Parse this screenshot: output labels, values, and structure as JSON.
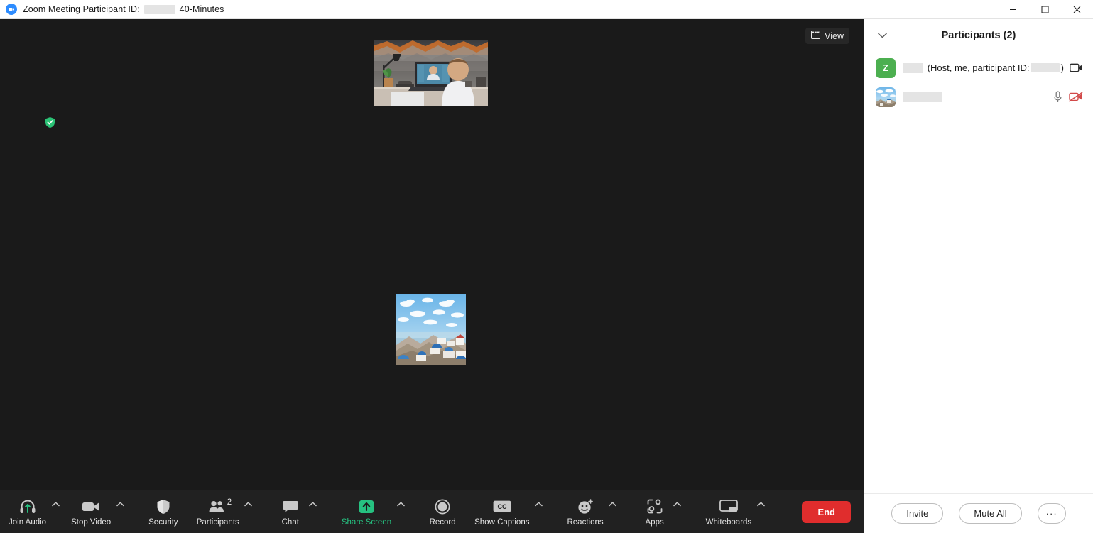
{
  "window": {
    "title_prefix": "Zoom Meeting Participant ID:",
    "title_suffix": "40-Minutes",
    "logo_icon": "zoom-logo-icon",
    "minimize_icon": "minimize-icon",
    "maximize_icon": "maximize-icon",
    "close_icon": "close-icon"
  },
  "stage": {
    "view_button_label": "View",
    "view_icon": "layout-grid-icon",
    "encryption_icon": "green-shield-check-icon",
    "speaker_thumbnail_alt": "participant-video-desk-laptop-call",
    "center_avatar_alt": "coastal-seaside-photo-avatar",
    "self_name_redacted": true,
    "background_color": "#1a1a1a"
  },
  "toolbar": {
    "background_color": "#212121",
    "items": [
      {
        "label": "Join Audio",
        "icon": "headset-audio-icon",
        "caret": true,
        "green": false
      },
      {
        "label": "Stop Video",
        "icon": "video-camera-icon",
        "caret": true,
        "green": false
      },
      {
        "label": "Security",
        "icon": "shield-icon",
        "caret": false,
        "green": false
      },
      {
        "label": "Participants",
        "icon": "participants-icon",
        "caret": true,
        "green": false,
        "badge": "2"
      },
      {
        "label": "Chat",
        "icon": "chat-bubble-icon",
        "caret": true,
        "green": false
      },
      {
        "label": "Share Screen",
        "icon": "share-screen-icon",
        "caret": true,
        "green": true
      },
      {
        "label": "Record",
        "icon": "record-circle-icon",
        "caret": false,
        "green": false
      },
      {
        "label": "Show Captions",
        "icon": "closed-caption-icon",
        "caret": true,
        "green": false
      },
      {
        "label": "Reactions",
        "icon": "reactions-smiley-icon",
        "caret": true,
        "green": false
      },
      {
        "label": "Apps",
        "icon": "apps-icon",
        "caret": true,
        "green": false
      },
      {
        "label": "Whiteboards",
        "icon": "whiteboard-icon",
        "caret": true,
        "green": false
      }
    ],
    "end_label": "End",
    "end_color": "#e02d2d"
  },
  "participants_panel": {
    "collapse_icon": "chevron-down-icon",
    "title": "Participants (2)",
    "rows": [
      {
        "avatar_type": "initial",
        "avatar_initial": "Z",
        "avatar_color": "#4caf50",
        "name_redacted": true,
        "meta_open": "(Host, me, participant ID:",
        "meta_close": ")",
        "icons": [
          "video-camera-icon"
        ]
      },
      {
        "avatar_type": "image",
        "avatar_alt": "coastal-seaside-photo-avatar",
        "name_redacted": true,
        "meta_open": "",
        "meta_close": "",
        "icons": [
          "microphone-icon",
          "video-camera-off-icon"
        ]
      }
    ],
    "invite_label": "Invite",
    "mute_all_label": "Mute All",
    "more_label": "···"
  }
}
